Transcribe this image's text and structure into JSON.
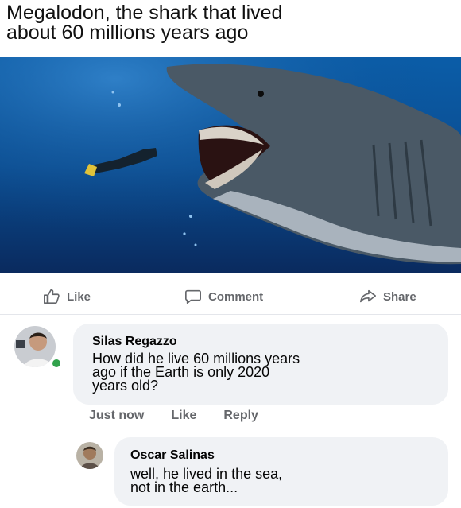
{
  "caption": {
    "line1": "Megalodon, the shark that lived",
    "line2": "about 60 millions years ago"
  },
  "post_actions": {
    "like": "Like",
    "comment": "Comment",
    "share": "Share"
  },
  "comments": [
    {
      "author": "Silas Regazzo",
      "lines": [
        "How did he live 60 millions years",
        "ago if the Earth is only 2020",
        "years old?"
      ],
      "time": "Just now",
      "like": "Like",
      "reply": "Reply",
      "online": true
    },
    {
      "author": "Oscar Salinas",
      "lines": [
        "well, he lived in the sea,",
        "not in the earth..."
      ]
    }
  ],
  "colors": {
    "ocean": "#0f4f8f",
    "online": "#31a24c",
    "bubble": "#f0f2f5",
    "meta_text": "#65676b"
  },
  "icons": {
    "like": "thumbs-up-icon",
    "comment": "speech-bubble-icon",
    "share": "share-arrow-icon"
  }
}
